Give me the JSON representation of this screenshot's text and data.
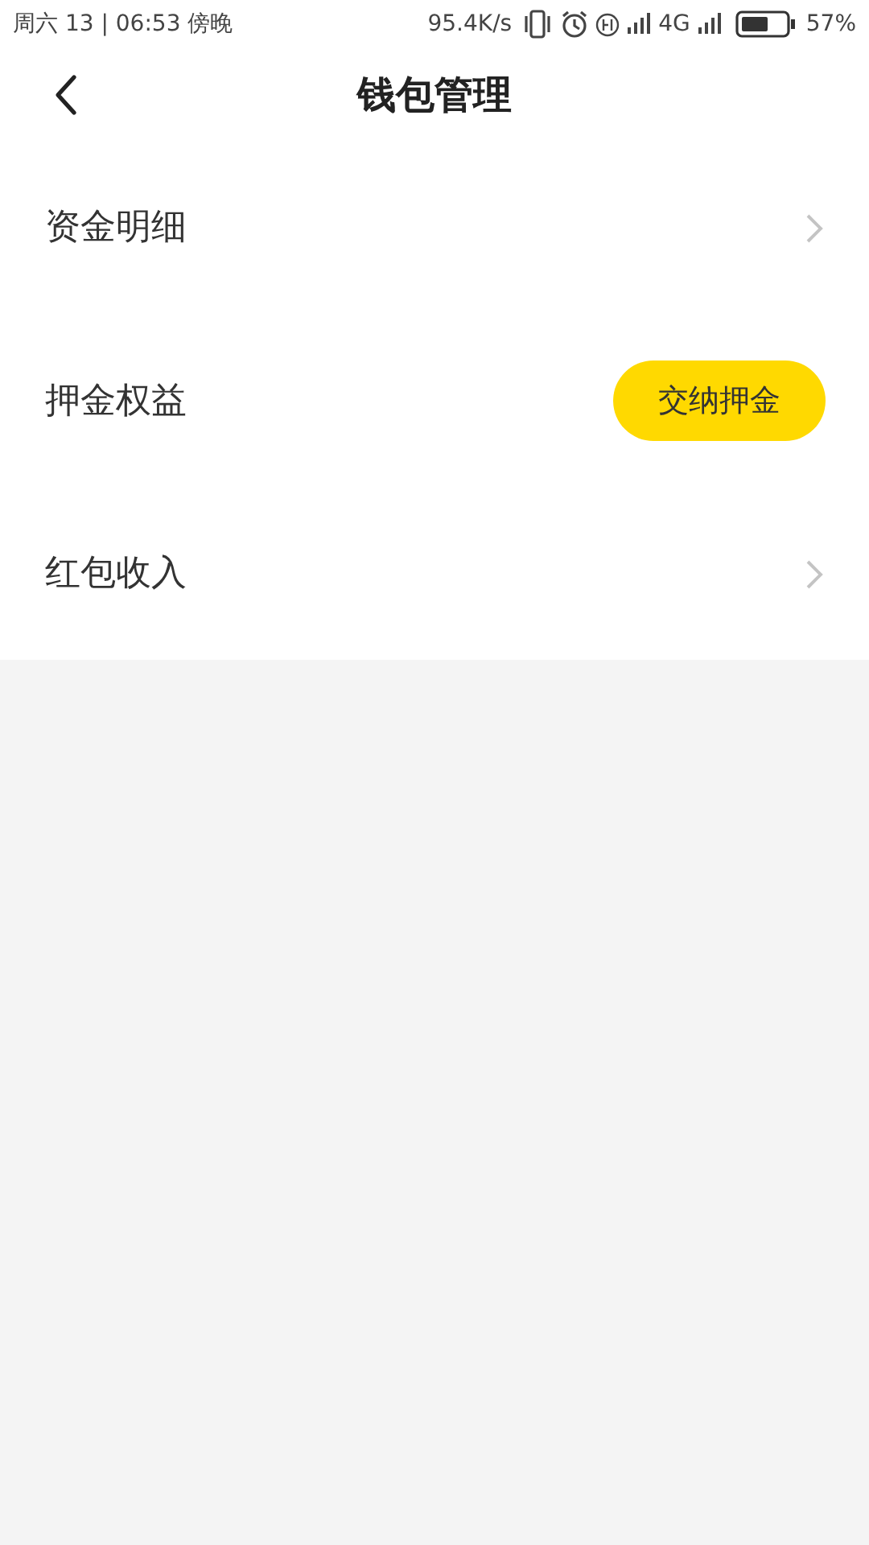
{
  "status_bar": {
    "left": "周六 13 | 06:53 傍晚",
    "speed": "95.4K/s",
    "network": "4G",
    "battery": "57%"
  },
  "header": {
    "title": "钱包管理"
  },
  "rows": [
    {
      "label": "资金明细",
      "kind": "link"
    },
    {
      "label": "押金权益",
      "kind": "button",
      "button": "交纳押金"
    },
    {
      "label": "红包收入",
      "kind": "link"
    }
  ]
}
